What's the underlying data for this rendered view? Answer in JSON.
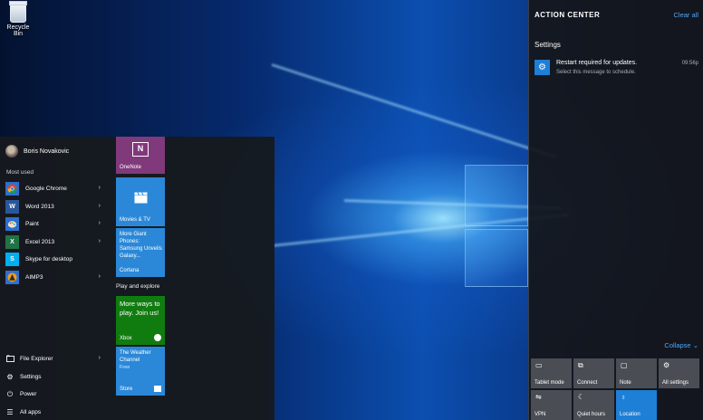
{
  "desktop": {
    "recycle_bin_label": "Recycle Bin"
  },
  "start_menu": {
    "user_name": "Boris Novakovic",
    "most_used_title": "Most used",
    "apps": [
      {
        "label": "Google Chrome",
        "icon": "chrome-icon",
        "has_submenu": true
      },
      {
        "label": "Word 2013",
        "icon": "word-icon",
        "has_submenu": true
      },
      {
        "label": "Paint",
        "icon": "paint-icon",
        "has_submenu": true
      },
      {
        "label": "Excel 2013",
        "icon": "excel-icon",
        "has_submenu": true
      },
      {
        "label": "Skype for desktop",
        "icon": "skype-icon",
        "has_submenu": false
      },
      {
        "label": "AIMP3",
        "icon": "aimp-icon",
        "has_submenu": true
      }
    ],
    "bottom_items": [
      {
        "label": "File Explorer",
        "icon": "folder-icon",
        "has_submenu": true
      },
      {
        "label": "Settings",
        "icon": "gear-icon",
        "has_submenu": false
      },
      {
        "label": "Power",
        "icon": "power-icon",
        "has_submenu": false
      },
      {
        "label": "All apps",
        "icon": "all-apps-icon",
        "has_submenu": false
      }
    ],
    "tiles": {
      "onenote": {
        "label": "OneNote",
        "color": "#80397b"
      },
      "movies": {
        "label": "Movies & TV",
        "color": "#2b88d8"
      },
      "cortana": {
        "label": "Cortana",
        "headline": "More Giant Phones: Samsung Unveils Galaxy...",
        "color": "#2b88d8"
      },
      "group_title": "Play and explore",
      "xbox": {
        "label": "Xbox",
        "text": "More ways to play. Join us!",
        "color": "#107c10"
      },
      "store": {
        "label": "Store",
        "headline": "The Weather Channel",
        "sub": "Free",
        "color": "#2b88d8"
      }
    }
  },
  "action_center": {
    "title": "ACTION CENTER",
    "clear_all": "Clear all",
    "group": "Settings",
    "notification": {
      "title": "Restart required for updates.",
      "body": "Select this message to schedule.",
      "time": "09:56p"
    },
    "collapse": "Collapse",
    "quick_actions": [
      {
        "label": "Tablet mode",
        "icon": "tablet-mode-icon",
        "on": false
      },
      {
        "label": "Connect",
        "icon": "connect-icon",
        "on": false
      },
      {
        "label": "Note",
        "icon": "note-icon",
        "on": false
      },
      {
        "label": "All settings",
        "icon": "gear-icon",
        "on": false
      },
      {
        "label": "VPN",
        "icon": "vpn-icon",
        "on": false
      },
      {
        "label": "Quiet hours",
        "icon": "moon-icon",
        "on": false
      },
      {
        "label": "Location",
        "icon": "location-icon",
        "on": true
      }
    ],
    "accent": "#1e7fd6",
    "link_color": "#4aa8ff"
  }
}
